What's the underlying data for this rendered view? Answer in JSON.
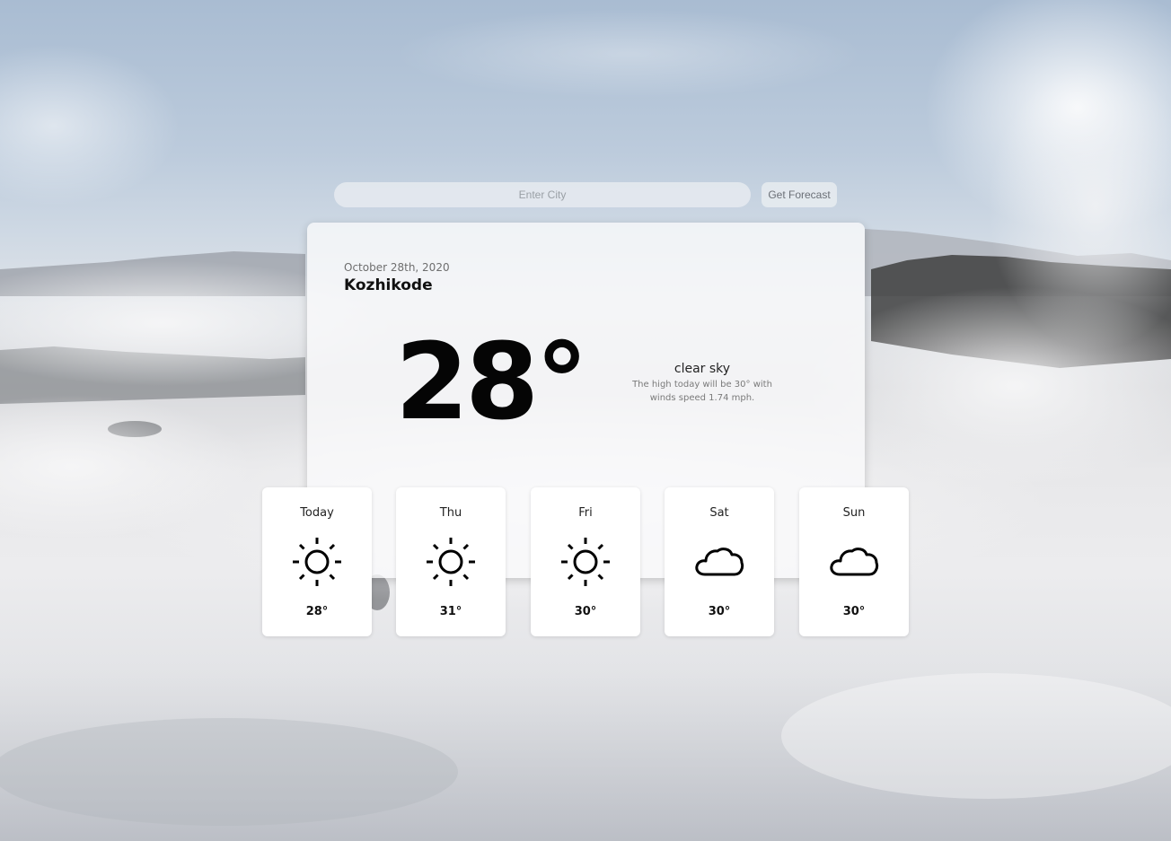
{
  "search": {
    "placeholder": "Enter City",
    "button_label": "Get Forecast"
  },
  "current": {
    "date": "October 28th, 2020",
    "city": "Kozhikode",
    "temperature": "28°",
    "description": "clear sky",
    "detail_line1": "The high today will be 30° with",
    "detail_line2": "winds speed 1.74 mph."
  },
  "forecast": [
    {
      "day": "Today",
      "icon": "sun-icon",
      "temp": "28°"
    },
    {
      "day": "Thu",
      "icon": "sun-icon",
      "temp": "31°"
    },
    {
      "day": "Fri",
      "icon": "sun-icon",
      "temp": "30°"
    },
    {
      "day": "Sat",
      "icon": "cloud-icon",
      "temp": "30°"
    },
    {
      "day": "Sun",
      "icon": "cloud-icon",
      "temp": "30°"
    }
  ],
  "colors": {
    "sky": "#a9bcd2",
    "mist": "#ececee",
    "card": "#ffffff",
    "text": "#111111"
  }
}
